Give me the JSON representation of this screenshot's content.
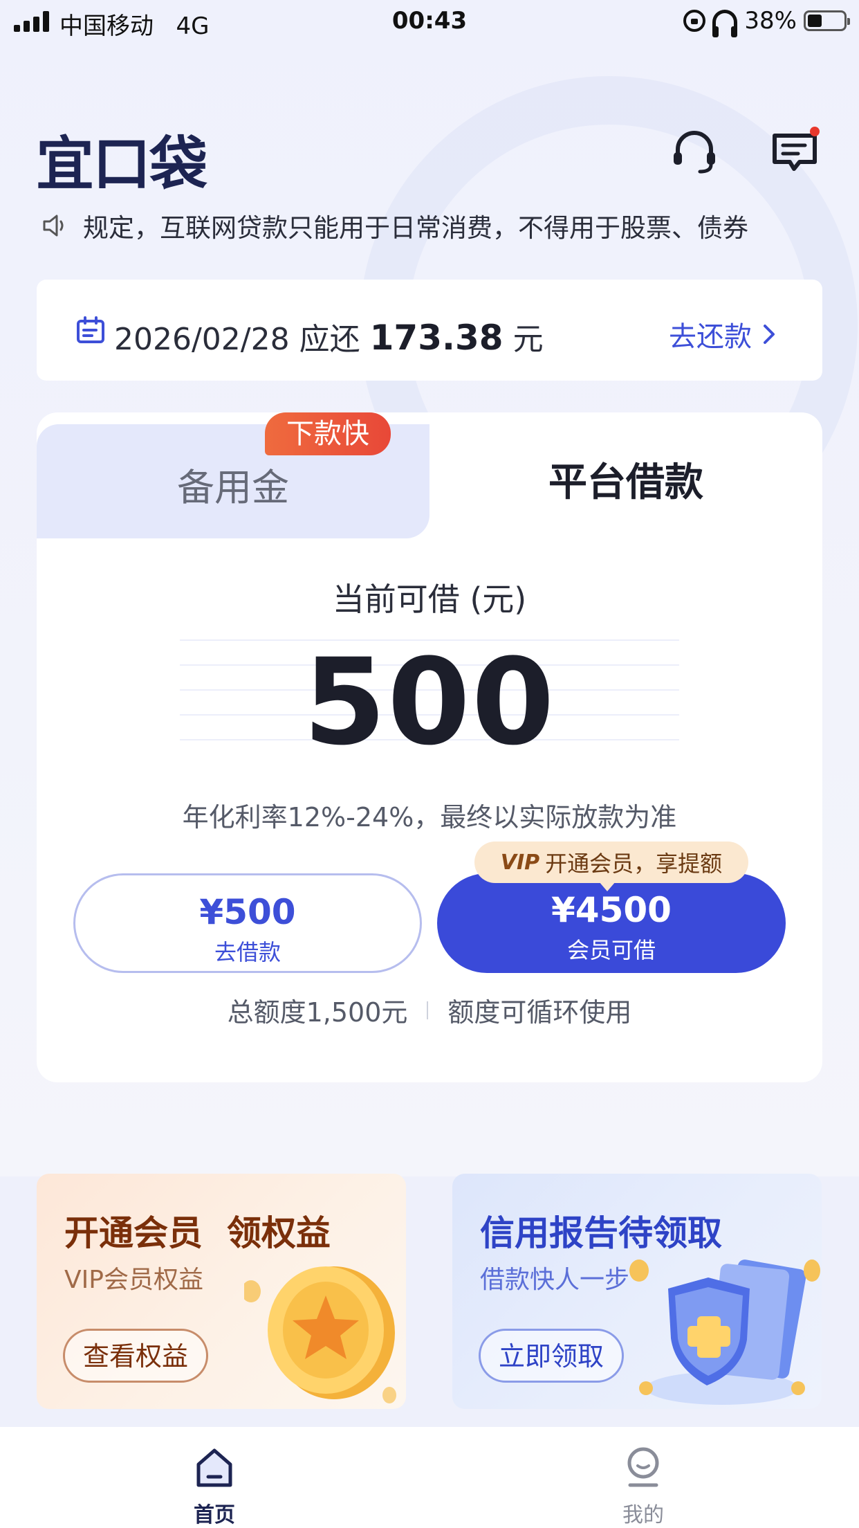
{
  "status_bar": {
    "carrier": "中国移动",
    "network": "4G",
    "time": "00:43",
    "battery": "38%"
  },
  "header": {
    "logo": "宜口袋",
    "notification_dot_color": "#e8382d"
  },
  "notice": {
    "text": "规定，互联网贷款只能用于日常消费，不得用于股票、债券"
  },
  "repay": {
    "date": "2026/02/28",
    "due_label": "应还",
    "amount": "173.38",
    "unit": "元",
    "action": "去还款"
  },
  "tabs": {
    "left": "备用金",
    "left_badge": "下款快",
    "right": "平台借款",
    "active": "平台借款"
  },
  "loan": {
    "current_label": "当前可借 (元)",
    "amount": "500",
    "rate_text": "年化利率12%-24%，最终以实际放款为准",
    "borrow_button": {
      "amount": "¥500",
      "label": "去借款"
    },
    "vip_button": {
      "amount": "¥4500",
      "label": "会员可借"
    },
    "vip_tip": {
      "mark": "VIP",
      "text": "开通会员，享提额"
    },
    "quota_total": "总额度1,500元",
    "quota_note": "额度可循环使用"
  },
  "promos": [
    {
      "title": "开通会员  领权益",
      "subtitle": "VIP会员权益",
      "button": "查看权益"
    },
    {
      "title": "信用报告待领取",
      "subtitle": "借款快人一步",
      "button": "立即领取"
    }
  ],
  "tabbar": {
    "home": "首页",
    "me": "我的"
  },
  "colors": {
    "primary": "#3a4ad9",
    "brand_dark": "#1d2452",
    "badge": "#e84838"
  },
  "icons": [
    "headset-icon",
    "message-icon",
    "speaker-icon",
    "bill-icon",
    "chevron-right-icon",
    "home-icon",
    "user-icon",
    "coin-illustration",
    "shield-illustration"
  ]
}
